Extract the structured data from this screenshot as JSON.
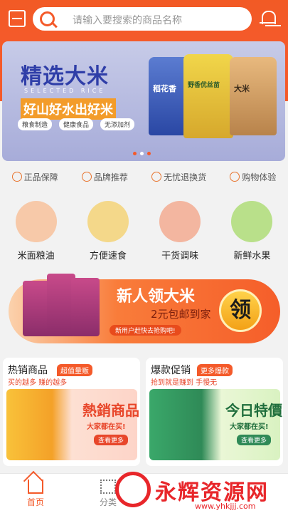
{
  "header": {
    "search_placeholder": "请输入要搜索的商品名称"
  },
  "banner": {
    "title": "精选大米",
    "subtitle_en": "SELECTED RICE",
    "slogan": "好山好水出好米",
    "tags": [
      "粮食制造",
      "健康食品",
      "无添加剂"
    ],
    "bags": [
      "稻花香",
      "野香优丝苗",
      "大米"
    ]
  },
  "guarantees": [
    "正品保障",
    "品牌推荐",
    "无忧退换货",
    "购物体验"
  ],
  "categories": [
    {
      "label": "米面粮油",
      "color": "#f7c9a9"
    },
    {
      "label": "方便速食",
      "color": "#f4d88a"
    },
    {
      "label": "干货调味",
      "color": "#f3b6a0"
    },
    {
      "label": "新鲜水果",
      "color": "#b9e08a"
    }
  ],
  "promo": {
    "title": "新人领大米",
    "subtitle": "2元包邮到家",
    "note": "新用户赶快去抢购吧!",
    "button": "领"
  },
  "cards": [
    {
      "title": "热销商品",
      "badge": "超值量贩",
      "sub": "买的越多 赚的越多",
      "big": "熱銷商品",
      "small": "大家都在买!",
      "go": "查看更多"
    },
    {
      "title": "爆款促销",
      "badge": "更多爆款",
      "sub": "抢到就是赚到 手慢无",
      "big": "今日特價",
      "small": "大家都在买!",
      "go": "查看更多"
    }
  ],
  "tabbar": {
    "home": "首页",
    "category": "分类"
  },
  "watermark": {
    "text": "永辉资源网",
    "url": "www.yhkjjj.com"
  }
}
